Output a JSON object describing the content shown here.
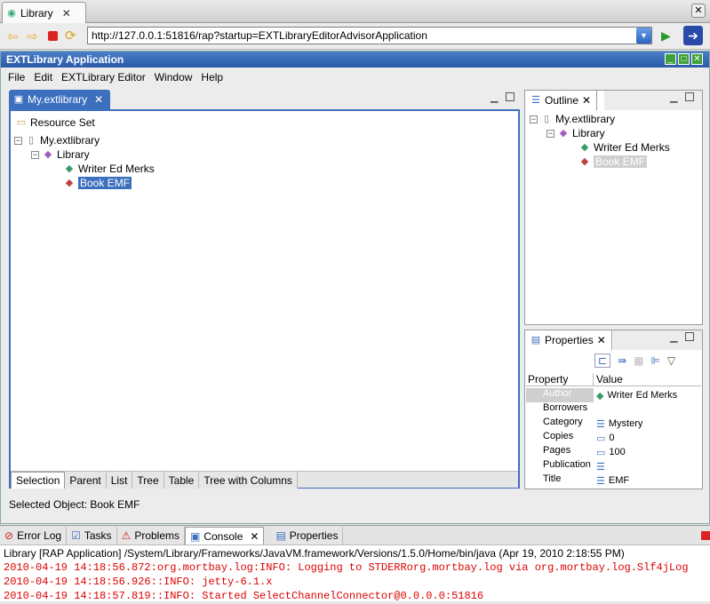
{
  "browser": {
    "tab_title": "Library",
    "url": "http://127.0.0.1:51816/rap?startup=EXTLibraryEditorAdvisorApplication"
  },
  "app": {
    "title": "EXTLibrary Application",
    "menu": [
      "File",
      "Edit",
      "EXTLibrary Editor",
      "Window",
      "Help"
    ]
  },
  "editor": {
    "tab_title": "My.extlibrary",
    "root": "Resource Set",
    "tree": {
      "file": "My.extlibrary",
      "library": "Library",
      "writer": "Writer Ed Merks",
      "book": "Book EMF"
    },
    "view_tabs": [
      "Selection",
      "Parent",
      "List",
      "Tree",
      "Table",
      "Tree with Columns"
    ],
    "status": "Selected Object: Book EMF"
  },
  "outline": {
    "title": "Outline",
    "file": "My.extlibrary",
    "library": "Library",
    "writer": "Writer Ed Merks",
    "book": "Book EMF"
  },
  "properties": {
    "title": "Properties",
    "col_property": "Property",
    "col_value": "Value",
    "rows": [
      {
        "name": "Author",
        "value": "Writer Ed Merks"
      },
      {
        "name": "Borrowers",
        "value": ""
      },
      {
        "name": "Category",
        "value": "Mystery"
      },
      {
        "name": "Copies",
        "value": "0"
      },
      {
        "name": "Pages",
        "value": "100"
      },
      {
        "name": "Publication",
        "value": ""
      },
      {
        "name": "Title",
        "value": "EMF"
      }
    ]
  },
  "bottom": {
    "tabs": [
      "Error Log",
      "Tasks",
      "Problems",
      "Console",
      "Properties"
    ],
    "console_header": "Library [RAP Application] /System/Library/Frameworks/JavaVM.framework/Versions/1.5.0/Home/bin/java (Apr 19, 2010 2:18:55 PM)",
    "console_lines": [
      "2010-04-19 14:18:56.872:org.mortbay.log:INFO:  Logging to STDERRorg.mortbay.log via org.mortbay.log.Slf4jLog",
      "2010-04-19 14:18:56.926::INFO:  jetty-6.1.x",
      "2010-04-19 14:18:57.819::INFO:  Started SelectChannelConnector@0.0.0.0:51816"
    ]
  }
}
